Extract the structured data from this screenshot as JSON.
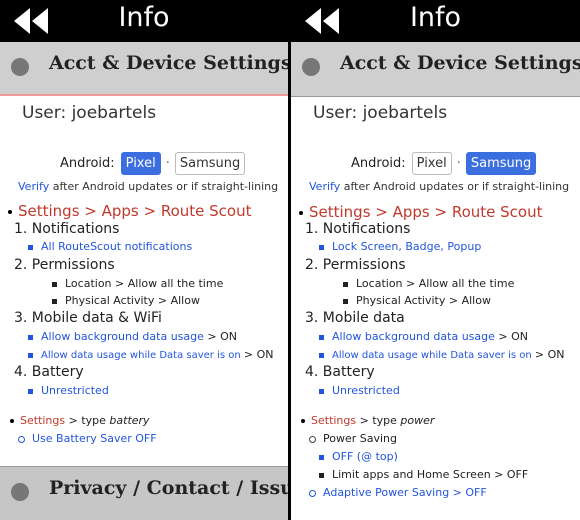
{
  "left": {
    "header_title": "Info",
    "section_top": "Acct & Device Settings",
    "user": "User: joebartels",
    "android_label": "Android:",
    "opt1": "Pixel",
    "opt2": "Samsung",
    "verify_link": "Verify",
    "verify_rest": "after Android updates or if straight-lining",
    "settings_path": "Settings > Apps > Route Scout",
    "n1": "1. Notifications",
    "n1a": "All RouteScout notifications",
    "n2": "2. Permissions",
    "n2a": "Location > Allow all the time",
    "n2b": "Physical Activity > Allow",
    "n3": "3. Mobile data & WiFi",
    "n3a_link": "Allow background data usage",
    "n3a_rest": "> ON",
    "n3b_link": "Allow data usage while Data saver is on",
    "n3b_rest": "> ON",
    "n4": "4. Battery",
    "n4a": "Unrestricted",
    "settings2_link": "Settings",
    "settings2_rest": "> type",
    "settings2_type": "battery",
    "saver": "Use Battery Saver OFF",
    "section_bottom": "Privacy / Contact / Issues"
  },
  "right": {
    "header_title": "Info",
    "section_top": "Acct & Device Settings",
    "user": "User: joebartels",
    "android_label": "Android:",
    "opt1": "Pixel",
    "opt2": "Samsung",
    "verify_link": "Verify",
    "verify_rest": "after Android updates or if straight-lining",
    "settings_path": "Settings > Apps > Route Scout",
    "n1": "1. Notifications",
    "n1a": "Lock Screen, Badge, Popup",
    "n2": "2. Permissions",
    "n2a": "Location > Allow all the time",
    "n2b": "Physical Activity > Allow",
    "n3": "3. Mobile data",
    "n3a_link": "Allow background data usage",
    "n3a_rest": "> ON",
    "n3b_link": "Allow data usage while Data saver is on",
    "n3b_rest": "> ON",
    "n4": "4. Battery",
    "n4a": "Unrestricted",
    "settings2_link": "Settings",
    "settings2_rest": "> type",
    "settings2_type": "power",
    "power_saving": "Power Saving",
    "off_top": "OFF (@ top)",
    "limit_apps": "Limit apps and Home Screen > OFF",
    "adaptive": "Adaptive Power Saving > OFF"
  },
  "colors": {
    "accent": "#3b6fe0",
    "link": "#2255dd",
    "red": "#c0392b"
  }
}
